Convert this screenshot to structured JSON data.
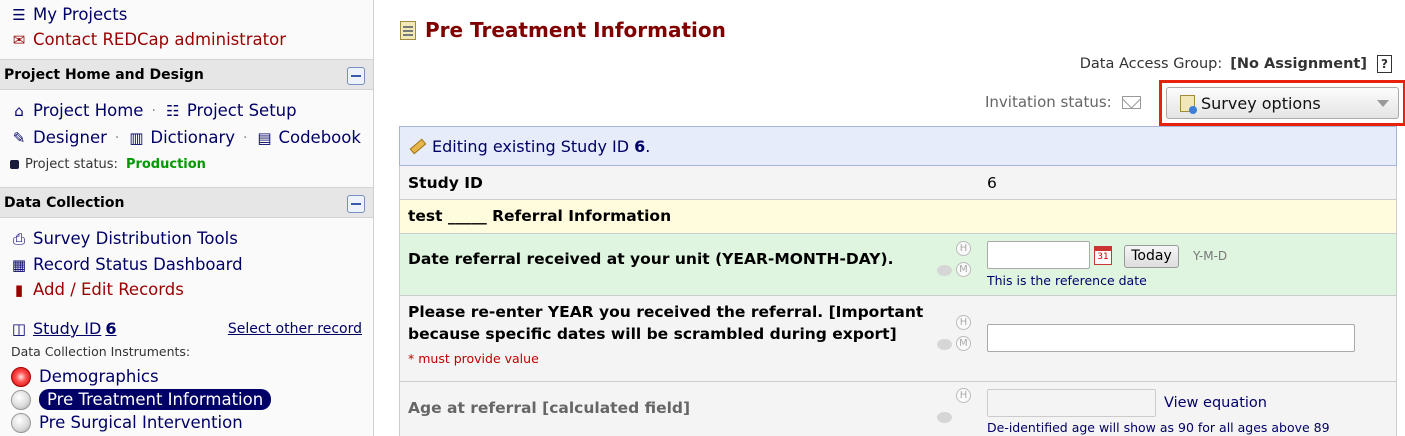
{
  "sidebar": {
    "my_projects": "My Projects",
    "contact_admin": "Contact REDCap administrator",
    "project_home_design": {
      "header": "Project Home and Design",
      "project_home": "Project Home",
      "project_setup": "Project Setup",
      "designer": "Designer",
      "dictionary": "Dictionary",
      "codebook": "Codebook",
      "status_label": "Project status:",
      "status_value": "Production",
      "separator": "·"
    },
    "data_collection": {
      "header": "Data Collection",
      "survey_tools": "Survey Distribution Tools",
      "record_status": "Record Status Dashboard",
      "add_edit": "Add / Edit Records",
      "record_label": "Study ID",
      "record_id": "6",
      "select_other": "Select other record",
      "instruments_label": "Data Collection Instruments:",
      "instruments": [
        {
          "label": "Demographics",
          "status": "incomplete"
        },
        {
          "label": "Pre Treatment Information",
          "status": "none"
        },
        {
          "label": "Pre Surgical Intervention",
          "status": "none"
        }
      ]
    }
  },
  "main": {
    "title": "Pre Treatment Information",
    "dag_label": "Data Access Group:",
    "dag_value": "[No Assignment]",
    "help": "?",
    "invitation_label": "Invitation status:",
    "survey_options": "Survey options",
    "editing_prefix": "Editing existing Study ID ",
    "editing_id": "6",
    "editing_suffix": ".",
    "fields": {
      "study_id_label": "Study ID",
      "study_id_value": "6",
      "section_header": "test _____ Referral Information",
      "date_label": "Date referral received at your unit (YEAR-MONTH-DAY).",
      "date_value": "",
      "today": "Today",
      "date_format": "Y-M-D",
      "date_note": "This is the reference date",
      "year_label_1": "Please re-enter YEAR you received the referral. [Important",
      "year_label_2": "because specific dates will be scrambled during export]",
      "required_note": "* must provide value",
      "age_label": "Age at referral [calculated field]",
      "view_equation": "View equation",
      "age_note": "De-identified age will show as 90 for all ages above 89",
      "h": "H",
      "m": "M",
      "cal_day": "31"
    }
  },
  "colors": {
    "link": "#000066",
    "title": "#800000",
    "production": "#009900",
    "highlight_box": "#e8210c"
  }
}
